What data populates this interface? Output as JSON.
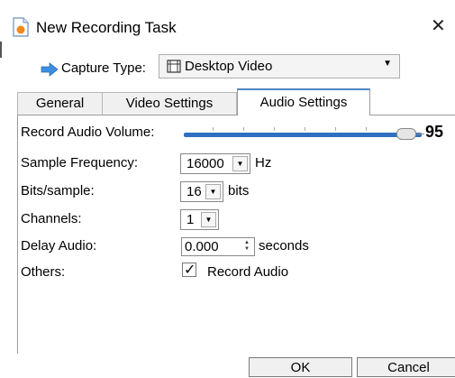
{
  "window": {
    "title": "New Recording Task",
    "close_icon": "close-icon"
  },
  "capture": {
    "label": "Capture Type:",
    "value": "Desktop Video",
    "icon": "film-icon"
  },
  "tabs": [
    {
      "label": "General",
      "active": false
    },
    {
      "label": "Video Settings",
      "active": false
    },
    {
      "label": "Audio Settings",
      "active": true
    }
  ],
  "audio": {
    "volume_label": "Record Audio Volume:",
    "volume_value": "95",
    "volume_level": 0.95,
    "sample_label": "Sample Frequency:",
    "sample_value": "16000",
    "sample_unit": "Hz",
    "bits_label": "Bits/sample:",
    "bits_value": "16",
    "bits_unit": "bits",
    "channels_label": "Channels:",
    "channels_value": "1",
    "delay_label": "Delay Audio:",
    "delay_value": "0.000",
    "delay_unit": "seconds",
    "others_label": "Others:",
    "record_audio_label": "Record Audio",
    "record_audio_checked": true
  },
  "buttons": {
    "ok": "OK",
    "cancel": "Cancel"
  },
  "colors": {
    "accent": "#2f6fc1",
    "tab_active_top": "#4f86c6"
  }
}
